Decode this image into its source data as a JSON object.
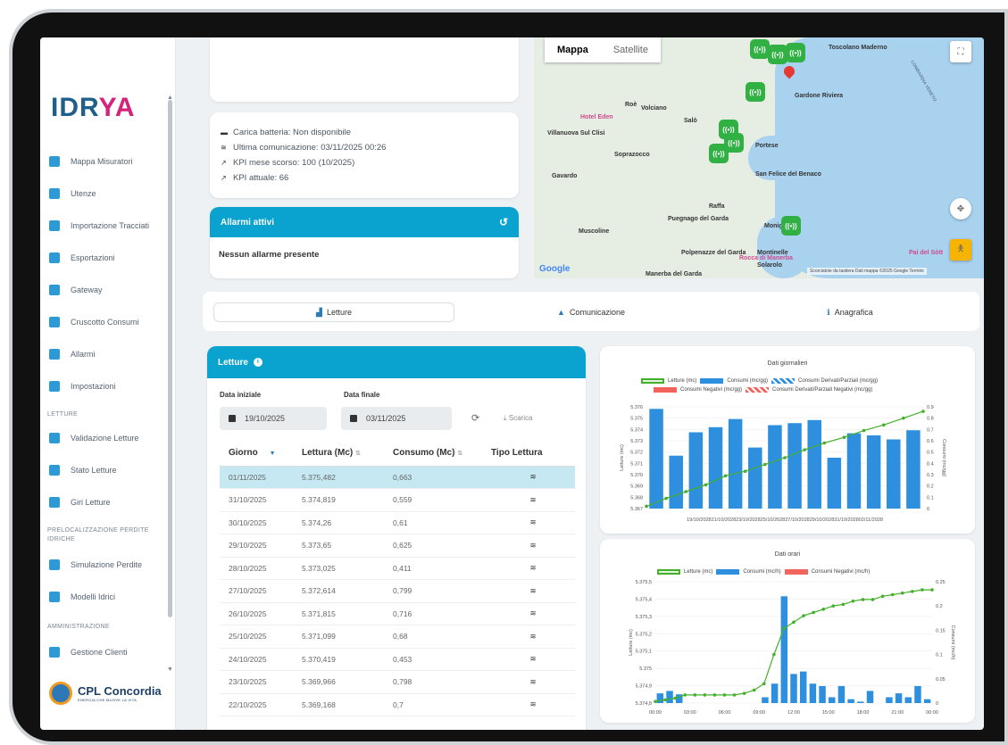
{
  "brand": {
    "logo_a": "IDR",
    "logo_b": "YA",
    "footer_name": "CPL Concordia",
    "footer_tag": "ENERGIA CHE MUOVE LA VITA"
  },
  "sidebar": {
    "items": [
      {
        "label": "Mappa Misuratori",
        "icon": "user-pin-icon"
      },
      {
        "label": "Utenze",
        "icon": "users-icon"
      },
      {
        "label": "Importazione Tracciati",
        "icon": "folder-icon"
      },
      {
        "label": "Esportazioni",
        "icon": "export-icon"
      },
      {
        "label": "Gateway",
        "icon": "gateway-icon"
      },
      {
        "label": "Cruscotto Consumi",
        "icon": "dashboard-icon"
      },
      {
        "label": "Allarmi",
        "icon": "alert-icon"
      },
      {
        "label": "Impostazioni",
        "icon": "settings-icon"
      }
    ],
    "section_letture": "LETTURE",
    "letture_items": [
      {
        "label": "Validazione Letture",
        "icon": "validate-icon"
      },
      {
        "label": "Stato Letture",
        "icon": "status-icon"
      },
      {
        "label": "Giri Letture",
        "icon": "route-icon"
      }
    ],
    "section_preloc": "PRELOCALIZZAZIONE PERDITE IDRICHE",
    "preloc_items": [
      {
        "label": "Simulazione Perdite",
        "icon": "pipe-icon"
      },
      {
        "label": "Modelli Idrici",
        "icon": "model-icon"
      }
    ],
    "section_admin": "AMMINISTRAZIONE",
    "admin_items": [
      {
        "label": "Gestione Clienti",
        "icon": "clients-icon"
      }
    ]
  },
  "info": {
    "battery": "Carica batteria: Non disponibile",
    "last_comm": "Ultima comunicazione: 03/11/2025 00:26",
    "kpi_last": "KPI mese scorso: 100 (10/2025)",
    "kpi_now": "KPI attuale: 66"
  },
  "alarms": {
    "title": "Allarmi attivi",
    "empty": "Nessun allarme presente"
  },
  "map": {
    "type_map": "Mappa",
    "type_sat": "Satellite",
    "places": [
      "Toscolano Maderno",
      "Gardone Riviera",
      "Hotel Eden",
      "Roè",
      "Volciano",
      "Salò",
      "Villanuova Sul Clisi",
      "Soprazocco",
      "Portese",
      "San Felice del Benaco",
      "Gavardo",
      "Raffa",
      "Puegnago del Garda",
      "Muscoline",
      "Polpenazze del Garda",
      "Rocca di Manerba",
      "Manerba del Garda",
      "Moniga",
      "Montinelle",
      "Solarolo",
      "LOMBARDIA VENETO",
      "Pai del Sòtt"
    ],
    "google": "Google",
    "attribution": "Scorciatoie da tastiera  Dati mappa ©2025 Google  Termini"
  },
  "tabs": [
    {
      "label": "Letture",
      "icon": "chart-icon"
    },
    {
      "label": "Comunicazione",
      "icon": "bell-icon"
    },
    {
      "label": "Anagrafica",
      "icon": "info-icon"
    }
  ],
  "letture": {
    "title": "Letture",
    "start_label": "Data iniziale",
    "start_value": "19/10/2025",
    "end_label": "Data finale",
    "end_value": "03/11/2025",
    "download": "Scarica",
    "headers": [
      "Giorno",
      "Lettura (Mc)",
      "Consumo (Mc)",
      "Tipo Lettura"
    ],
    "rows": [
      [
        "01/11/2025",
        "5.375,482",
        "0,663"
      ],
      [
        "31/10/2025",
        "5.374,819",
        "0,559"
      ],
      [
        "30/10/2025",
        "5.374,26",
        "0,61"
      ],
      [
        "29/10/2025",
        "5.373,65",
        "0,625"
      ],
      [
        "28/10/2025",
        "5.373,025",
        "0,411"
      ],
      [
        "27/10/2025",
        "5.372,614",
        "0,799"
      ],
      [
        "26/10/2025",
        "5.371,815",
        "0,716"
      ],
      [
        "25/10/2025",
        "5.371,099",
        "0,68"
      ],
      [
        "24/10/2025",
        "5.370,419",
        "0,453"
      ],
      [
        "23/10/2025",
        "5.369,966",
        "0,798"
      ],
      [
        "22/10/2025",
        "5.369,168",
        "0,7"
      ]
    ]
  },
  "chart_data": [
    {
      "type": "bar",
      "title": "Dati giornalieri",
      "legend": [
        "Letture (mc)",
        "Consumi (mc/gg)",
        "Consumi Derivati/Parziali (mc/gg)",
        "Consumi Negativi (mc/gg)",
        "Consumi Derivati/Parziali Negativi (mc/gg)"
      ],
      "ylabel_left": "Letture (mc)",
      "ylabel_right": "Consumi (mc/gg)",
      "y_left_ticks": [
        "5.376",
        "5.375",
        "5.374",
        "5.373",
        "5.372",
        "5.371",
        "5.370",
        "5.369",
        "5.368",
        "5.367"
      ],
      "y_right_ticks": [
        "0.9",
        "0.8",
        "0.7",
        "0.6",
        "0.5",
        "0.4",
        "0.3",
        "0.2",
        "0.1",
        "0"
      ],
      "x_labels": "19/10/202821/10/202823/10/202825/10/202827/10/202829/10/202831/10/202802/11/2028",
      "ylim_left": [
        5367,
        5376
      ],
      "ylim_right": [
        0,
        1
      ],
      "bars": [
        0.98,
        0.52,
        0.75,
        0.8,
        0.88,
        0.6,
        0.82,
        0.84,
        0.87,
        0.5,
        0.74,
        0.72,
        0.68,
        0.77
      ],
      "line": [
        5367.2,
        5367.9,
        5368.5,
        5369.1,
        5369.9,
        5370.3,
        5370.9,
        5371.5,
        5372.2,
        5372.8,
        5373.3,
        5373.9,
        5374.4,
        5375.0,
        5375.6
      ]
    },
    {
      "type": "bar",
      "title": "Dati orari",
      "legend": [
        "Letture (mc)",
        "Consumi (mc/h)",
        "Consumi Negativi (mc/h)"
      ],
      "ylabel_left": "Letture (mc)",
      "ylabel_right": "Consumi (mc/h)",
      "y_left_ticks": [
        "5.375,5",
        "5.375,4",
        "5.375,3",
        "5.375,2",
        "5.375,1",
        "5.375",
        "5.374,9",
        "5.374,8"
      ],
      "y_right_ticks": [
        "0.25",
        "0.2",
        "0.15",
        "0.1",
        "0.05",
        "0"
      ],
      "x_labels": [
        "00:00",
        "03:00",
        "06:00",
        "09:00",
        "12:00",
        "15:00",
        "18:00",
        "21:00",
        "00:00"
      ],
      "ylim_left": [
        5374.8,
        5375.55
      ],
      "ylim_right": [
        0,
        0.25
      ],
      "bars": [
        0.02,
        0.025,
        0.018,
        0,
        0,
        0,
        0,
        0,
        0,
        0,
        0,
        0.012,
        0.04,
        0.22,
        0.06,
        0.065,
        0.04,
        0.035,
        0.012,
        0.035,
        0.008,
        0.003,
        0.025,
        0,
        0.012,
        0.02,
        0.012,
        0.035,
        0.008
      ],
      "line": [
        5374.81,
        5374.82,
        5374.83,
        5374.85,
        5374.85,
        5374.85,
        5374.85,
        5374.85,
        5374.85,
        5374.86,
        5374.88,
        5374.92,
        5375.1,
        5375.26,
        5375.3,
        5375.34,
        5375.36,
        5375.38,
        5375.4,
        5375.41,
        5375.43,
        5375.44,
        5375.44,
        5375.46,
        5375.47,
        5375.48,
        5375.49,
        5375.5,
        5375.5
      ]
    }
  ]
}
